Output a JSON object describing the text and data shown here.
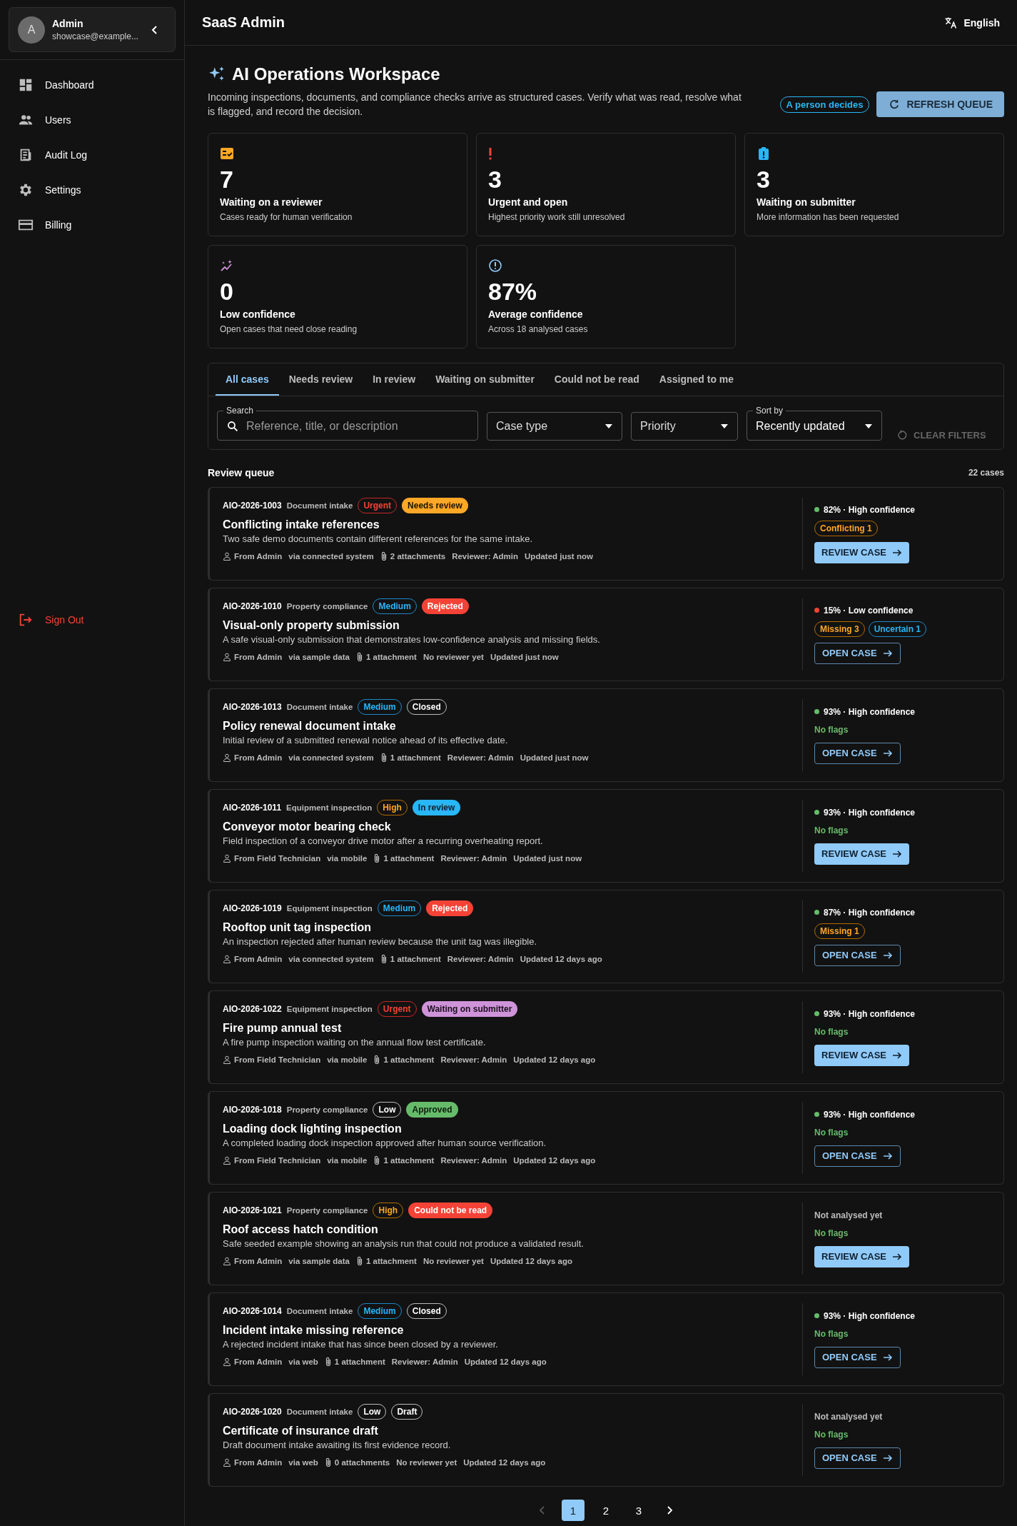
{
  "sidebar": {
    "user": {
      "initial": "A",
      "name": "Admin",
      "email": "showcase@example..."
    },
    "items": [
      {
        "label": "Dashboard"
      },
      {
        "label": "Users"
      },
      {
        "label": "Audit Log"
      },
      {
        "label": "Settings"
      },
      {
        "label": "Billing"
      }
    ],
    "sign_out": "Sign Out"
  },
  "header": {
    "title": "SaaS Admin",
    "language": "English"
  },
  "workspace": {
    "title": "AI Operations Workspace",
    "description": "Incoming inspections, documents, and compliance checks arrive as structured cases. Verify what was read, resolve what is flagged, and record the decision.",
    "badge": "A person decides",
    "refresh_button": "REFRESH QUEUE"
  },
  "stats": [
    {
      "value": "7",
      "label": "Waiting on a reviewer",
      "detail": "Cases ready for human verification"
    },
    {
      "value": "3",
      "label": "Urgent and open",
      "detail": "Highest priority work still unresolved"
    },
    {
      "value": "3",
      "label": "Waiting on submitter",
      "detail": "More information has been requested"
    },
    {
      "value": "0",
      "label": "Low confidence",
      "detail": "Open cases that need close reading"
    },
    {
      "value": "87%",
      "label": "Average confidence",
      "detail": "Across 18 analysed cases"
    }
  ],
  "tabs": [
    {
      "label": "All cases",
      "selected": true
    },
    {
      "label": "Needs review",
      "selected": false
    },
    {
      "label": "In review",
      "selected": false
    },
    {
      "label": "Waiting on submitter",
      "selected": false
    },
    {
      "label": "Could not be read",
      "selected": false
    },
    {
      "label": "Assigned to me",
      "selected": false
    }
  ],
  "filters": {
    "search_label": "Search",
    "search_placeholder": "Reference, title, or description",
    "case_type": "Case type",
    "priority": "Priority",
    "sort_label": "Sort by",
    "sort_value": "Recently updated",
    "clear_button": "CLEAR FILTERS"
  },
  "queue": {
    "title": "Review queue",
    "count": "22 cases",
    "cases": [
      {
        "ref": "AIO-2026-1003",
        "type": "Document intake",
        "priority": {
          "label": "Urgent",
          "kind": "urgent"
        },
        "status": {
          "label": "Needs review",
          "kind": "needs_review"
        },
        "title": "Conflicting intake references",
        "description": "Two safe demo documents contain different references for the same intake.",
        "from": "From Admin",
        "via": "via connected system",
        "attachments": "2 attachments",
        "reviewer": "Reviewer: Admin",
        "updated": "Updated just now",
        "confidence": {
          "text": "82% · High confidence",
          "color": "#66bb6a"
        },
        "flags": [
          {
            "label": "Conflicting 1",
            "kind": "warning"
          }
        ],
        "action": {
          "label": "REVIEW CASE",
          "kind": "review"
        }
      },
      {
        "ref": "AIO-2026-1010",
        "type": "Property compliance",
        "priority": {
          "label": "Medium",
          "kind": "medium"
        },
        "status": {
          "label": "Rejected",
          "kind": "rejected"
        },
        "title": "Visual-only property submission",
        "description": "A safe visual-only submission that demonstrates low-confidence analysis and missing fields.",
        "from": "From Admin",
        "via": "via sample data",
        "attachments": "1 attachment",
        "reviewer": "No reviewer yet",
        "updated": "Updated just now",
        "confidence": {
          "text": "15% · Low confidence",
          "color": "#f44336"
        },
        "flags": [
          {
            "label": "Missing 3",
            "kind": "warning"
          },
          {
            "label": "Uncertain 1",
            "kind": "info"
          }
        ],
        "action": {
          "label": "OPEN CASE",
          "kind": "open"
        }
      },
      {
        "ref": "AIO-2026-1013",
        "type": "Document intake",
        "priority": {
          "label": "Medium",
          "kind": "medium"
        },
        "status": {
          "label": "Closed",
          "kind": "closed"
        },
        "title": "Policy renewal document intake",
        "description": "Initial review of a submitted renewal notice ahead of its effective date.",
        "from": "From Admin",
        "via": "via connected system",
        "attachments": "1 attachment",
        "reviewer": "Reviewer: Admin",
        "updated": "Updated just now",
        "confidence": {
          "text": "93% · High confidence",
          "color": "#66bb6a"
        },
        "no_flags": "No flags",
        "action": {
          "label": "OPEN CASE",
          "kind": "open"
        }
      },
      {
        "ref": "AIO-2026-1011",
        "type": "Equipment inspection",
        "priority": {
          "label": "High",
          "kind": "high"
        },
        "status": {
          "label": "In review",
          "kind": "in_review"
        },
        "title": "Conveyor motor bearing check",
        "description": "Field inspection of a conveyor drive motor after a recurring overheating report.",
        "from": "From Field Technician",
        "via": "via mobile",
        "attachments": "1 attachment",
        "reviewer": "Reviewer: Admin",
        "updated": "Updated just now",
        "confidence": {
          "text": "93% · High confidence",
          "color": "#66bb6a"
        },
        "no_flags": "No flags",
        "action": {
          "label": "REVIEW CASE",
          "kind": "review"
        }
      },
      {
        "ref": "AIO-2026-1019",
        "type": "Equipment inspection",
        "priority": {
          "label": "Medium",
          "kind": "medium"
        },
        "status": {
          "label": "Rejected",
          "kind": "rejected"
        },
        "title": "Rooftop unit tag inspection",
        "description": "An inspection rejected after human review because the unit tag was illegible.",
        "from": "From Admin",
        "via": "via connected system",
        "attachments": "1 attachment",
        "reviewer": "Reviewer: Admin",
        "updated": "Updated 12 days ago",
        "confidence": {
          "text": "87% · High confidence",
          "color": "#66bb6a"
        },
        "flags": [
          {
            "label": "Missing 1",
            "kind": "warning"
          }
        ],
        "action": {
          "label": "OPEN CASE",
          "kind": "open"
        }
      },
      {
        "ref": "AIO-2026-1022",
        "type": "Equipment inspection",
        "priority": {
          "label": "Urgent",
          "kind": "urgent"
        },
        "status": {
          "label": "Waiting on submitter",
          "kind": "waiting"
        },
        "title": "Fire pump annual test",
        "description": "A fire pump inspection waiting on the annual flow test certificate.",
        "from": "From Field Technician",
        "via": "via mobile",
        "attachments": "1 attachment",
        "reviewer": "Reviewer: Admin",
        "updated": "Updated 12 days ago",
        "confidence": {
          "text": "93% · High confidence",
          "color": "#66bb6a"
        },
        "no_flags": "No flags",
        "action": {
          "label": "REVIEW CASE",
          "kind": "review"
        }
      },
      {
        "ref": "AIO-2026-1018",
        "type": "Property compliance",
        "priority": {
          "label": "Low",
          "kind": "low"
        },
        "status": {
          "label": "Approved",
          "kind": "approved"
        },
        "title": "Loading dock lighting inspection",
        "description": "A completed loading dock inspection approved after human source verification.",
        "from": "From Field Technician",
        "via": "via mobile",
        "attachments": "1 attachment",
        "reviewer": "Reviewer: Admin",
        "updated": "Updated 12 days ago",
        "confidence": {
          "text": "93% · High confidence",
          "color": "#66bb6a"
        },
        "no_flags": "No flags",
        "action": {
          "label": "OPEN CASE",
          "kind": "open"
        }
      },
      {
        "ref": "AIO-2026-1021",
        "type": "Property compliance",
        "priority": {
          "label": "High",
          "kind": "high"
        },
        "status": {
          "label": "Could not be read",
          "kind": "unreadable"
        },
        "title": "Roof access hatch condition",
        "description": "Safe seeded example showing an analysis run that could not produce a validated result.",
        "from": "From Admin",
        "via": "via sample data",
        "attachments": "1 attachment",
        "reviewer": "No reviewer yet",
        "updated": "Updated 12 days ago",
        "confidence": {
          "text": "Not analysed yet"
        },
        "no_flags": "No flags",
        "action": {
          "label": "REVIEW CASE",
          "kind": "review"
        }
      },
      {
        "ref": "AIO-2026-1014",
        "type": "Document intake",
        "priority": {
          "label": "Medium",
          "kind": "medium"
        },
        "status": {
          "label": "Closed",
          "kind": "closed"
        },
        "title": "Incident intake missing reference",
        "description": "A rejected incident intake that has since been closed by a reviewer.",
        "from": "From Admin",
        "via": "via web",
        "attachments": "1 attachment",
        "reviewer": "Reviewer: Admin",
        "updated": "Updated 12 days ago",
        "confidence": {
          "text": "93% · High confidence",
          "color": "#66bb6a"
        },
        "no_flags": "No flags",
        "action": {
          "label": "OPEN CASE",
          "kind": "open"
        }
      },
      {
        "ref": "AIO-2026-1020",
        "type": "Document intake",
        "priority": {
          "label": "Low",
          "kind": "low"
        },
        "status": {
          "label": "Draft",
          "kind": "draft"
        },
        "title": "Certificate of insurance draft",
        "description": "Draft document intake awaiting its first evidence record.",
        "from": "From Admin",
        "via": "via web",
        "attachments": "0 attachments",
        "reviewer": "No reviewer yet",
        "updated": "Updated 12 days ago",
        "confidence": {
          "text": "Not analysed yet"
        },
        "no_flags": "No flags",
        "action": {
          "label": "OPEN CASE",
          "kind": "open"
        }
      }
    ]
  },
  "pagination": {
    "previous_disabled": true,
    "pages": [
      {
        "label": "1",
        "selected": true
      },
      {
        "label": "2",
        "selected": false
      },
      {
        "label": "3",
        "selected": false
      }
    ]
  }
}
